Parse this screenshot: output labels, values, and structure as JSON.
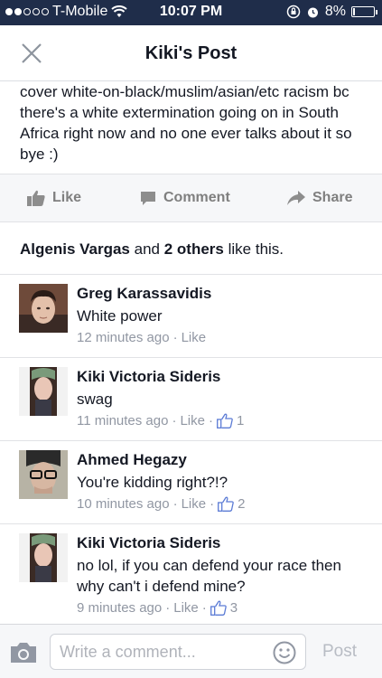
{
  "status_bar": {
    "carrier": "T-Mobile",
    "time": "10:07 PM",
    "battery_percent": "8%",
    "battery_level": 0.08,
    "signal_bars": 2
  },
  "nav": {
    "title": "Kiki's Post"
  },
  "post": {
    "text": "cover white-on-black/muslim/asian/etc racism bc there's a white extermination going on in South Africa right now and no one ever talks about it so bye :)"
  },
  "actions": {
    "like": "Like",
    "comment": "Comment",
    "share": "Share"
  },
  "likes_summary": {
    "name": "Algenis Vargas",
    "and": "and",
    "others": "2 others",
    "suffix": "like this."
  },
  "comments": [
    {
      "name": "Greg Karassavidis",
      "text": "White power",
      "time": "12 minutes ago",
      "like_label": "Like",
      "like_count": ""
    },
    {
      "name": "Kiki Victoria Sideris",
      "text": "swag",
      "time": "11 minutes ago",
      "like_label": "Like",
      "like_count": "1"
    },
    {
      "name": "Ahmed Hegazy",
      "text": "You're kidding right?!?",
      "time": "10 minutes ago",
      "like_label": "Like",
      "like_count": "2"
    },
    {
      "name": "Kiki Victoria Sideris",
      "text": "no lol, if you can defend your race then why can't i defend mine?",
      "time": "9 minutes ago",
      "like_label": "Like",
      "like_count": "3"
    }
  ],
  "composer": {
    "placeholder": "Write a comment...",
    "post_label": "Post"
  },
  "colors": {
    "status_bar": "#1f2d4a",
    "meta_text": "#9197a3",
    "action_text": "#7f7f7f",
    "like_blue": "#5b7bd5"
  }
}
